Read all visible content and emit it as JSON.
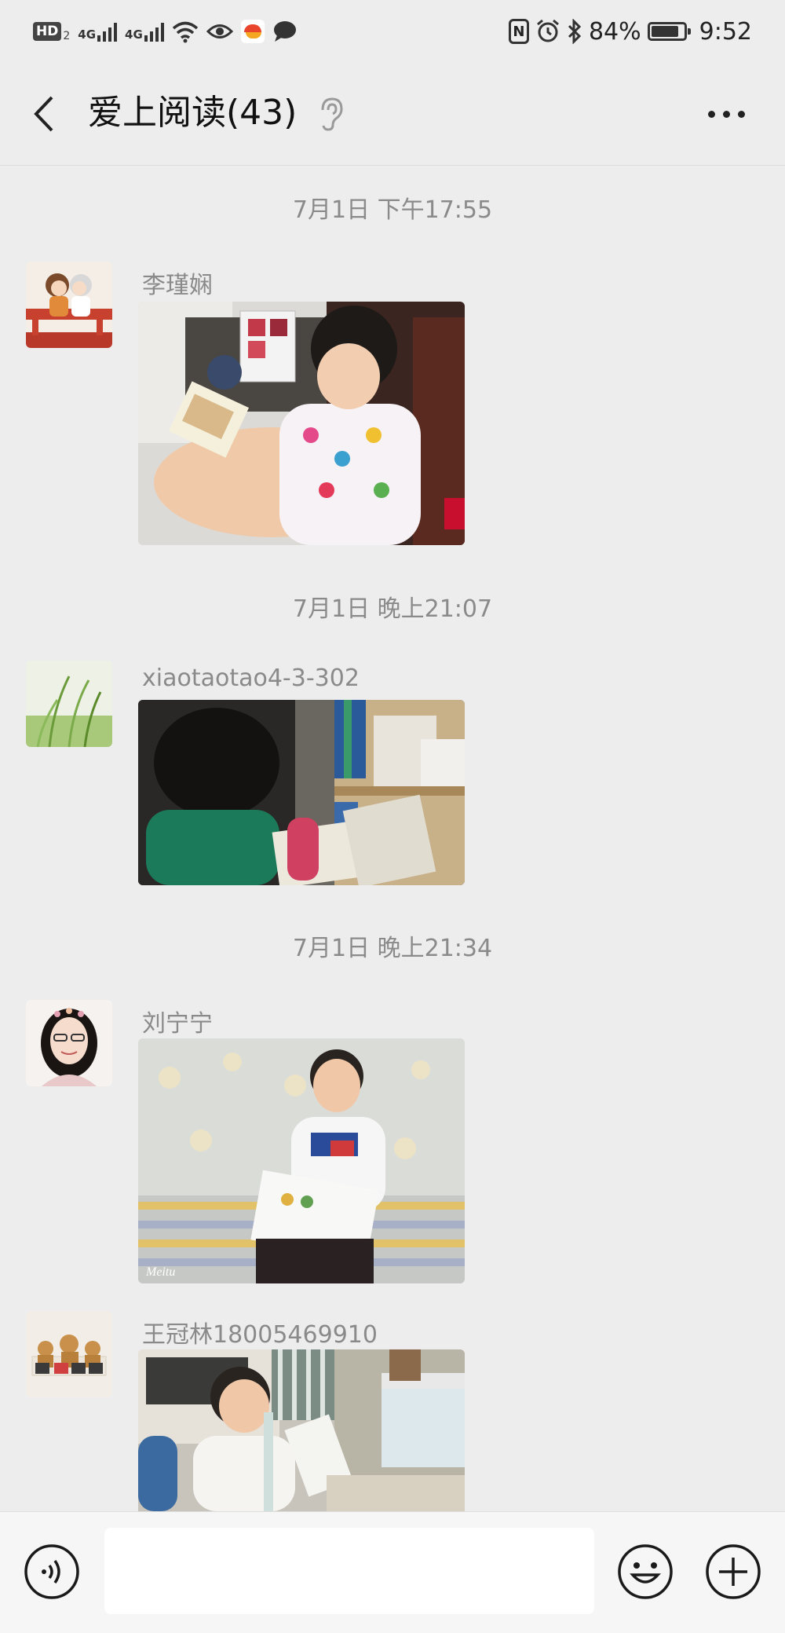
{
  "status_bar": {
    "hd": "HD",
    "hd_sub": "2",
    "network1": "4G",
    "network2": "4G",
    "battery_percent": "84%",
    "time": "9:52"
  },
  "header": {
    "title": "爱上阅读(43)"
  },
  "messages": [
    {
      "time": "7月1日 下午17:55",
      "sender": "李瑾娴"
    },
    {
      "time": "7月1日 晚上21:07",
      "sender": "xiaotaotao4-3-302"
    },
    {
      "time": "7月1日 晚上21:34",
      "sender": "刘宁宁",
      "photo_watermark": "Meitu"
    },
    {
      "sender": "王冠林18005469910"
    }
  ],
  "colors": {
    "background": "#ededed",
    "input_bar": "#f6f6f6",
    "secondary_text": "#8a8a8a"
  }
}
